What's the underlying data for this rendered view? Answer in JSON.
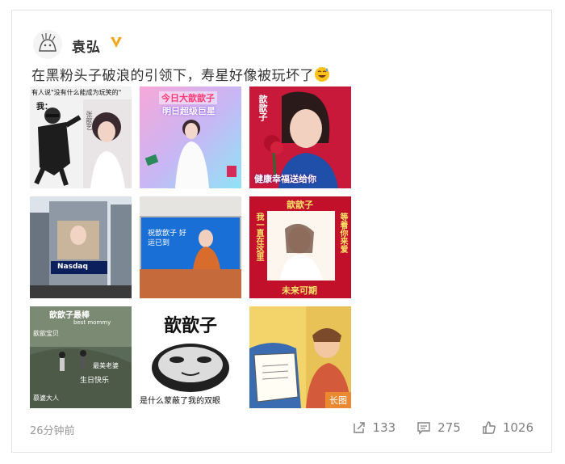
{
  "post": {
    "author": "袁弘",
    "verified_badge_color": "#f5a623",
    "text": "在黑粉头子破浪的引领下，寿星好像被玩坏了",
    "emoji": "grinning-sweat-emoji",
    "timestamp": "26分钟前"
  },
  "images": [
    {
      "id": "img1",
      "banner": "有人说\"没有什么能成为玩笑的\"",
      "label": "我：",
      "side_label": "张歆艺"
    },
    {
      "id": "img2",
      "banner": "今日大歆歆子",
      "sub": "明日超级巨星"
    },
    {
      "id": "img3",
      "vertical": "歆歆子",
      "bottom": "健康幸福送给你"
    },
    {
      "id": "img4",
      "caption": "Nasdaq"
    },
    {
      "id": "img5",
      "screen": "祝歆歆子 好运已到"
    },
    {
      "id": "img6",
      "top": "歆歆子",
      "left": "我一直在这里",
      "right": "等着你来爱",
      "bottom": "未来可期"
    },
    {
      "id": "img7",
      "words": [
        "歆歆子最棒",
        "歆歆宝贝",
        "生日快乐",
        "慕婆大人",
        "最美老婆",
        "best mommy"
      ]
    },
    {
      "id": "img8",
      "big": "歆歆子",
      "caption": "是什么蒙蔽了我的双眼"
    },
    {
      "id": "img9",
      "tag": "长图"
    }
  ],
  "stats": {
    "repost_count": "133",
    "comment_count": "275",
    "like_count": "1026"
  },
  "colors": {
    "text_main": "#333333",
    "text_muted": "#999999",
    "long_image_tag": "#e98a33"
  }
}
